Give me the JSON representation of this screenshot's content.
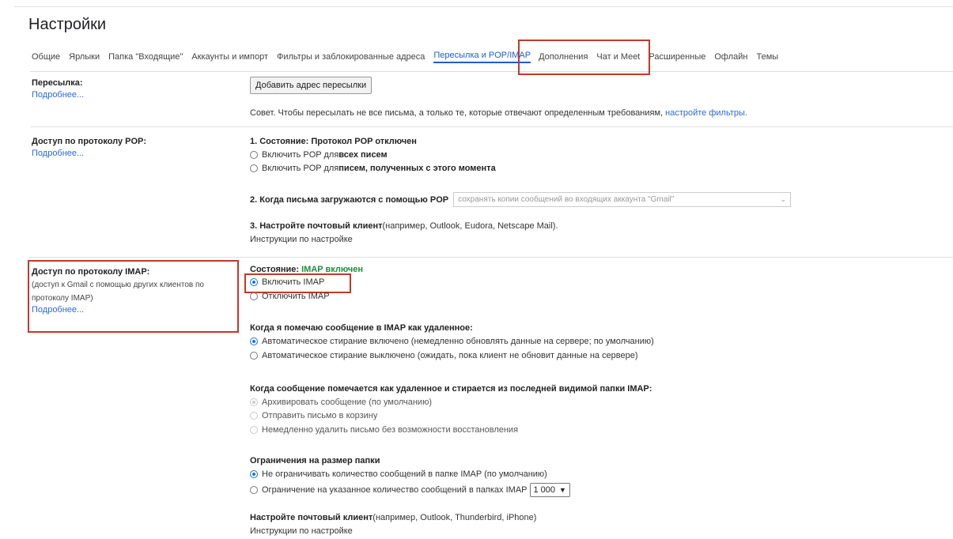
{
  "page": {
    "title": "Настройки"
  },
  "tabs": [
    {
      "label": "Общие"
    },
    {
      "label": "Ярлыки"
    },
    {
      "label": "Папка \"Входящие\""
    },
    {
      "label": "Аккаунты и импорт"
    },
    {
      "label": "Фильтры и заблокированные адреса"
    },
    {
      "label": "Пересылка и POP/IMAP",
      "active": true
    },
    {
      "label": "Дополнения"
    },
    {
      "label": "Чат и Meet"
    },
    {
      "label": "Расширенные"
    },
    {
      "label": "Офлайн"
    },
    {
      "label": "Темы"
    }
  ],
  "forwarding": {
    "title": "Пересылка:",
    "learn_more": "Подробнее...",
    "add_button": "Добавить адрес пересылки",
    "tip_text": "Совет. Чтобы пересылать не все письма, а только те, которые отвечают определенным требованиям,",
    "tip_link": "настройте фильтры."
  },
  "pop": {
    "title": "Доступ по протоколу POP:",
    "learn_more": "Подробнее...",
    "status": "1. Состояние: Протокол POP отключен",
    "opt1_prefix": "Включить POP для ",
    "opt1_bold": "всех писем",
    "opt2_prefix": "Включить POP для ",
    "opt2_bold": "писем, полученных с этого момента",
    "when_label": "2. Когда письма загружаются с помощью POP",
    "when_select": "сохранять копии сообщений во входящих аккаунта \"Gmail\"",
    "client_bold": "3. Настройте почтовый клиент",
    "client_rest": " (например, Outlook, Eudora, Netscape Mail).",
    "instructions": "Инструкции по настройке"
  },
  "imap": {
    "title": "Доступ по протоколу IMAP:",
    "subtitle_1": "(доступ к Gmail с помощью других клиентов по",
    "subtitle_2": "протоколу IMAP)",
    "learn_more": "Подробнее...",
    "status_label": "Состояние: ",
    "status_value": "IMAP включен",
    "enable": "Включить IMAP",
    "disable": "Отключить IMAP",
    "deleted_heading": "Когда я помечаю сообщение в IMAP как удаленное:",
    "deleted_opt1": "Автоматическое стирание включено (немедленно обновлять данные на сервере; по умолчанию)",
    "deleted_opt2": "Автоматическое стирание выключено (ожидать, пока клиент не обновит данные на сервере)",
    "expunge_heading": "Когда сообщение помечается как удаленное и стирается из последней видимой папки IMAP:",
    "expunge_opt1": "Архивировать сообщение (по умолчанию)",
    "expunge_opt2": "Отправить письмо в корзину",
    "expunge_opt3": "Немедленно удалить письмо без возможности восстановления",
    "folder_heading": "Ограничения на размер папки",
    "folder_opt1": "Не ограничивать количество сообщений в папке IMAP (по умолчанию)",
    "folder_opt2": "Ограничение на указанное количество сообщений в папках IMAP",
    "folder_limit": "1 000",
    "client_bold": "Настройте почтовый клиент",
    "client_rest": " (например, Outlook, Thunderbird, iPhone)",
    "instructions": "Инструкции по настройке"
  }
}
